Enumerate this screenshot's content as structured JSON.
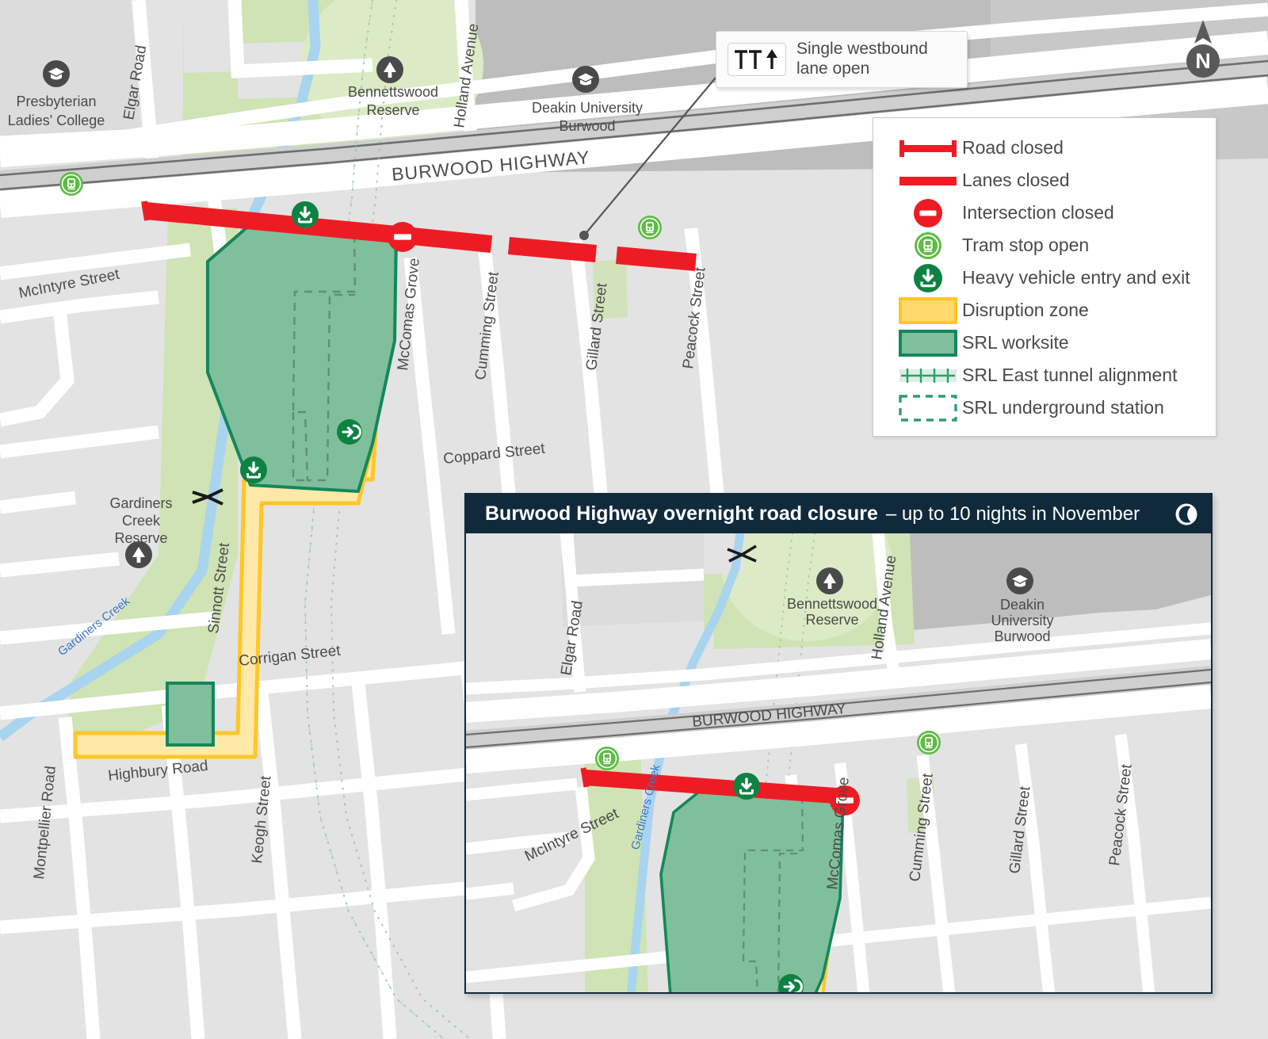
{
  "callout": {
    "icon": "lane-diagram-icon",
    "text_line1": "Single westbound",
    "text_line2": "lane open",
    "lanes_blocked": 2,
    "lanes_open": 1
  },
  "north_arrow": {
    "label": "N"
  },
  "legend": {
    "items": [
      {
        "symbol": "road-closed-line",
        "label": "Road closed",
        "color": "#ED1C24"
      },
      {
        "symbol": "lanes-closed-line",
        "label": "Lanes closed",
        "color": "#ED1C24"
      },
      {
        "symbol": "intersection-closed-icon",
        "label": "Intersection closed",
        "color": "#ED1C24"
      },
      {
        "symbol": "tram-stop-icon",
        "label": "Tram stop open",
        "color": "#5FBB46"
      },
      {
        "symbol": "heavy-vehicle-icon",
        "label": "Heavy vehicle entry and exit",
        "color": "#0E8242"
      },
      {
        "symbol": "disruption-zone-swatch",
        "label": "Disruption zone",
        "color": "#FFD24D"
      },
      {
        "symbol": "srl-worksite-swatch",
        "label": "SRL worksite",
        "color": "#7FBF9B"
      },
      {
        "symbol": "srl-tunnel-line",
        "label": "SRL East tunnel alignment",
        "color": "#2E9E6B"
      },
      {
        "symbol": "srl-station-swatch",
        "label": "SRL underground station",
        "color": "#2E9E6B"
      }
    ]
  },
  "inset": {
    "title_strong": "Burwood Highway overnight road closure",
    "title_rest": "– up to 10 nights in November",
    "icon": "moon-icon"
  },
  "main_map": {
    "highway_label": "BURWOOD HIGHWAY",
    "pois": [
      {
        "name": "Presbyterian Ladies' College",
        "icon": "school-icon",
        "lines": [
          "Presbyterian",
          "Ladies' College"
        ]
      },
      {
        "name": "Bennettswood Reserve",
        "icon": "park-tree-icon",
        "lines": [
          "Bennettswood",
          "Reserve"
        ]
      },
      {
        "name": "Deakin University Burwood",
        "icon": "school-icon",
        "lines": [
          "Deakin University",
          "Burwood"
        ]
      },
      {
        "name": "Gardiners Creek Reserve",
        "icon": "park-tree-icon",
        "lines": [
          "Gardiners",
          "Creek",
          "Reserve"
        ]
      }
    ],
    "streets": [
      "Elgar Road",
      "Holland Avenue",
      "McIntyre Street",
      "McComas Grove",
      "Cumming Street",
      "Gillard Street",
      "Peacock Street",
      "Coppard Street",
      "Sinnott Street",
      "Corrigan Street",
      "Keogh Street",
      "Highbury Road",
      "Montpellier Road"
    ],
    "waterway": "Gardiners Creek",
    "markers": {
      "tram_stops": 2,
      "heavy_vehicle_entries": 2,
      "site_access": 1,
      "intersection_closed": 1
    }
  },
  "inset_map": {
    "highway_label": "BURWOOD HIGHWAY",
    "pois": [
      {
        "name": "Bennettswood Reserve",
        "icon": "park-tree-icon",
        "lines": [
          "Bennettswood",
          "Reserve"
        ]
      },
      {
        "name": "Deakin University Burwood",
        "icon": "school-icon",
        "lines": [
          "Deakin",
          "University",
          "Burwood"
        ]
      }
    ],
    "streets": [
      "Elgar Road",
      "Holland Avenue",
      "McIntyre Street",
      "McComas Grove",
      "Cumming Street",
      "Gillard Street",
      "Peacock Street"
    ],
    "waterway": "Gardiners Creek",
    "markers": {
      "tram_stops": 2,
      "heavy_vehicle_entries": 1,
      "site_access": 1,
      "intersection_closed": 1
    }
  },
  "colors": {
    "road_closed": "#ED1C24",
    "worksite_fill": "#7FBF9B",
    "worksite_stroke": "#14875B",
    "disruption_fill": "#FFE9A8",
    "disruption_stroke": "#FFC629",
    "park_green": "#CFE3B4",
    "water_blue": "#A8D4F0",
    "building_grey": "#BDBDBD",
    "block_grey": "#E3E3E3",
    "road_white": "#FFFFFF",
    "tram_green": "#5FBB46",
    "heavy_green": "#0E8242",
    "header_navy": "#102A3C"
  }
}
